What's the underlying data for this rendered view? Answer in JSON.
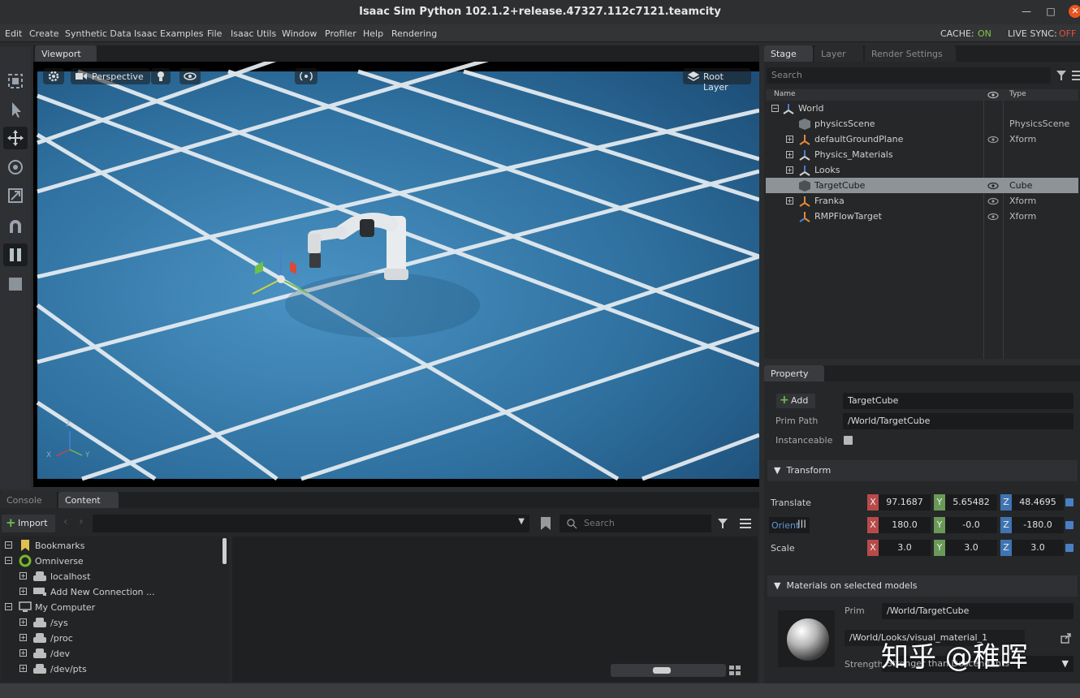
{
  "window": {
    "title": "Isaac Sim Python 102.1.2+release.47327.112c7121.teamcity"
  },
  "menu": [
    "Edit",
    "Create",
    "Synthetic Data",
    "Isaac Examples",
    "File",
    "Isaac Utils",
    "Window",
    "Profiler",
    "Help",
    "Rendering"
  ],
  "status": {
    "cache_label": "CACHE:",
    "cache_value": "ON",
    "live_sync_label": "LIVE SYNC:",
    "live_sync_value": "OFF"
  },
  "viewport": {
    "tab": "Viewport",
    "camera": "Perspective",
    "root_layer": "Root Layer",
    "axes": {
      "z": "Z",
      "x": "X",
      "y": "Y"
    }
  },
  "stage": {
    "tabs": [
      "Stage",
      "Layer",
      "Render Settings"
    ],
    "search_placeholder": "Search",
    "col_name": "Name",
    "col_type": "Type",
    "rows": [
      {
        "name": "World",
        "type": ""
      },
      {
        "name": "physicsScene",
        "type": "PhysicsScene"
      },
      {
        "name": "defaultGroundPlane",
        "type": "Xform"
      },
      {
        "name": "Physics_Materials",
        "type": ""
      },
      {
        "name": "Looks",
        "type": ""
      },
      {
        "name": "TargetCube",
        "type": "Cube"
      },
      {
        "name": "Franka",
        "type": "Xform"
      },
      {
        "name": "RMPFlowTarget",
        "type": "Xform"
      }
    ]
  },
  "property": {
    "tab": "Property",
    "add_label": "Add",
    "name_value": "TargetCube",
    "prim_path_label": "Prim Path",
    "prim_path_value": "/World/TargetCube",
    "instanceable_label": "Instanceable",
    "transform_label": "Transform",
    "translate_label": "Translate",
    "orient_label": "Orient",
    "scale_label": "Scale",
    "translate": [
      "97.1687",
      "5.65482",
      "48.4695"
    ],
    "orient": [
      "180.0",
      "-0.0",
      "-180.0"
    ],
    "scale": [
      "3.0",
      "3.0",
      "3.0"
    ],
    "axis_letters": [
      "X",
      "Y",
      "Z"
    ],
    "materials_label": "Materials on selected models",
    "prim_label": "Prim",
    "prim_value": "/World/TargetCube",
    "material_path": "/World/Looks/visual_material_1",
    "strength_label": "Strength",
    "strength_value": "Stronger than Descendants"
  },
  "content": {
    "tabs": [
      "Console",
      "Content"
    ],
    "import_label": "Import",
    "search_placeholder": "Search",
    "tree": [
      {
        "label": "Bookmarks",
        "indent": 0
      },
      {
        "label": "Omniverse",
        "indent": 0
      },
      {
        "label": "localhost",
        "indent": 1
      },
      {
        "label": "Add New Connection ...",
        "indent": 1
      },
      {
        "label": "My Computer",
        "indent": 0
      },
      {
        "label": "/sys",
        "indent": 1
      },
      {
        "label": "/proc",
        "indent": 1
      },
      {
        "label": "/dev",
        "indent": 1
      },
      {
        "label": "/dev/pts",
        "indent": 1
      }
    ]
  },
  "watermark": "知乎 @稚晖"
}
